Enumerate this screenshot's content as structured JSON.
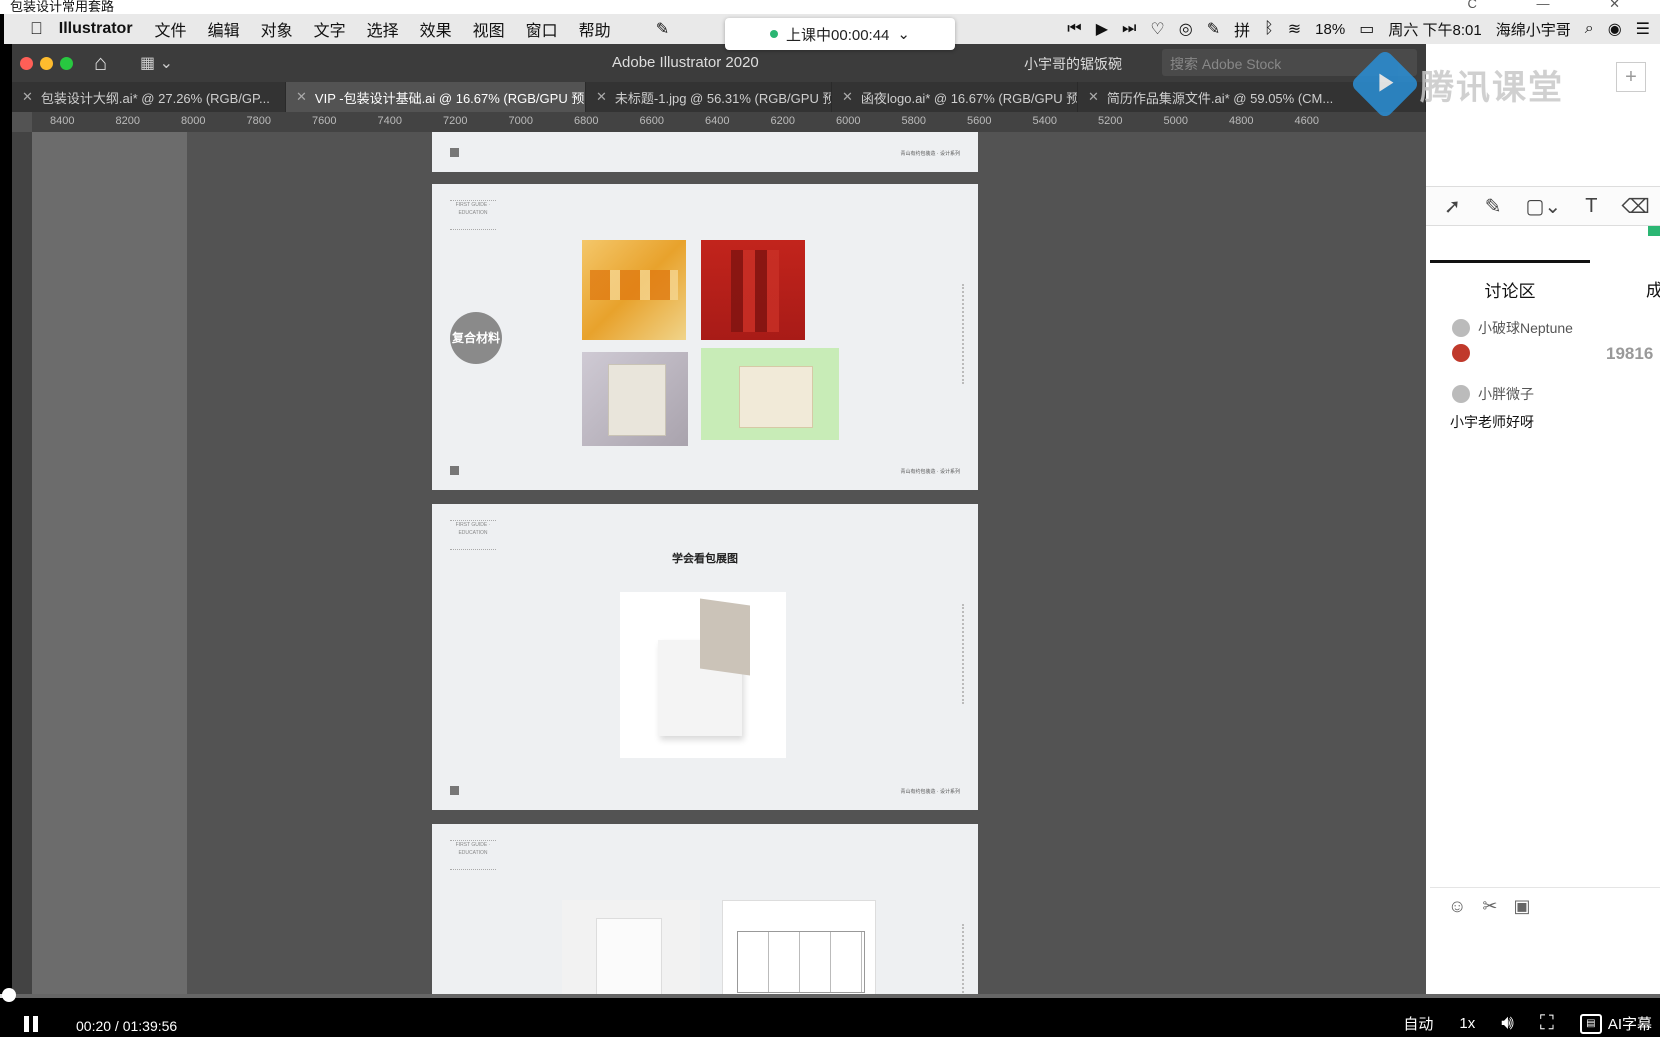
{
  "player": {
    "window_title": "包装设计常用套路",
    "window_buttons": "C — ✕",
    "time_current": "00:20",
    "time_total": "01:39:56",
    "time_display": "00:20 / 01:39:56",
    "progress": 0.0033,
    "controls": {
      "auto": "自动",
      "speed": "1x",
      "subtitle": "AI字幕"
    }
  },
  "menubar": {
    "app": "Illustrator",
    "items": [
      "文件",
      "编辑",
      "对象",
      "文字",
      "选择",
      "效果",
      "视图",
      "窗口",
      "帮助"
    ],
    "battery": "18%",
    "clock": "周六 下午8:01",
    "user": "海绵小宇哥"
  },
  "class_timer": {
    "label": "上课中00:00:44"
  },
  "illustrator": {
    "title": "Adobe Illustrator 2020",
    "workspace": "小宇哥的锯饭碗",
    "search_placeholder": "搜索 Adobe Stock",
    "tabs": [
      {
        "label": "包装设计大纲.ai* @ 27.26% (RGB/GP..."
      },
      {
        "label": "VIP -包装设计基础.ai @ 16.67% (RGB/GPU 预览)"
      },
      {
        "label": "未标题-1.jpg @ 56.31% (RGB/GPU 预..."
      },
      {
        "label": "函夜logo.ai* @ 16.67% (RGB/GPU 预..."
      },
      {
        "label": "简历作品集源文件.ai* @ 59.05% (CM..."
      }
    ],
    "ruler_marks": [
      "8400",
      "8200",
      "8000",
      "7800",
      "7600",
      "7400",
      "7200",
      "7000",
      "6800",
      "6600",
      "6400",
      "6200",
      "6000",
      "5800",
      "5600",
      "5400",
      "5200",
      "5000",
      "4800",
      "4600"
    ],
    "artboards": {
      "badge": "复合材料",
      "section_title": "学会看包展图",
      "footer": "青山有约包装造 · 设计系列",
      "brand": "FIRST GUIDE · EDUCATION"
    }
  },
  "tencent": {
    "logo": "腾讯课堂",
    "plus": "+",
    "tab_discussion": "讨论区",
    "tab_other": "成",
    "messages": [
      {
        "user": "小破球Neptune",
        "text": ""
      },
      {
        "user": "小胖微子",
        "text": "小宇老师好呀"
      }
    ],
    "number": "19816"
  },
  "colors": {
    "accent_green": "#2bb673",
    "ai_bg": "#535353",
    "tencent_blue": "#2a8fd6"
  },
  "icons": [
    "apple-icon",
    "home-icon",
    "layout-icon",
    "search-icon",
    "play-icon",
    "pause-icon",
    "volume-icon",
    "fullscreen-icon",
    "emoji-icon",
    "scissors-icon",
    "image-icon",
    "pen-icon",
    "cursor-icon",
    "rect-icon",
    "text-icon",
    "eraser-icon"
  ]
}
